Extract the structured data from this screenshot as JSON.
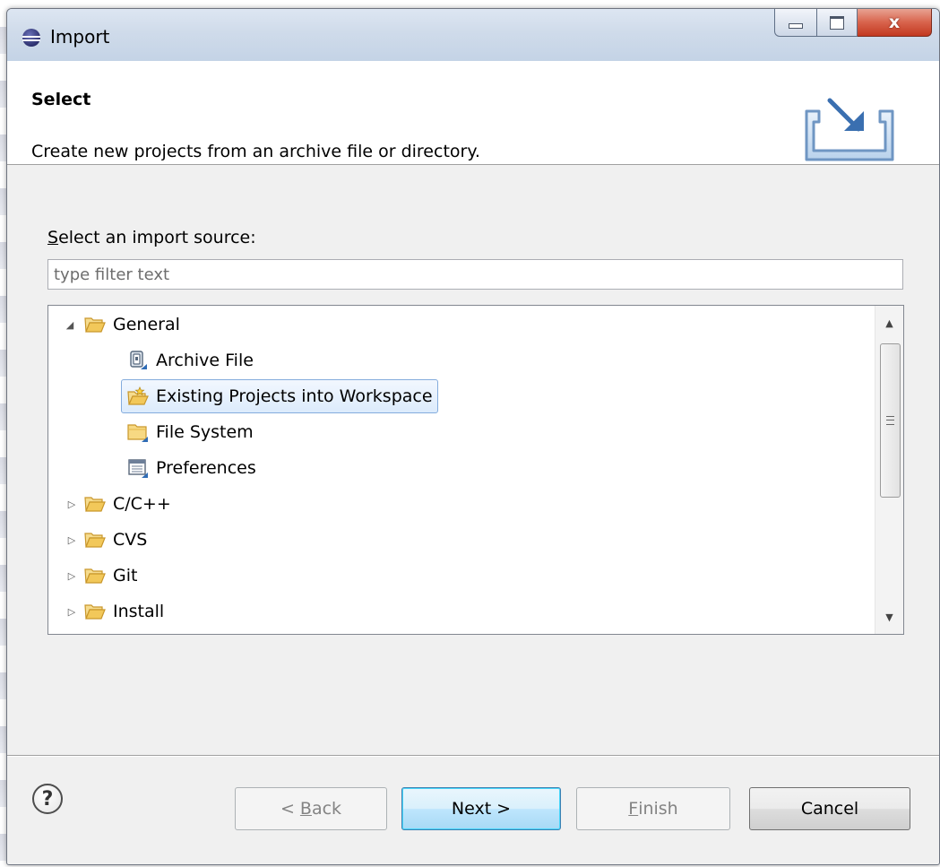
{
  "window": {
    "title": "Import",
    "controls": {
      "close_glyph": "x"
    }
  },
  "header": {
    "title": "Select",
    "description": "Create new projects from an archive file or directory.",
    "icon": "import-wizard-icon"
  },
  "source": {
    "label_mnemonic": "S",
    "label_rest": "elect an import source:",
    "filter_placeholder": "type filter text",
    "filter_value": ""
  },
  "tree": {
    "rows": [
      {
        "label": "General",
        "level": 0,
        "expanded": true,
        "icon": "folder-open-icon"
      },
      {
        "label": "Archive File",
        "level": 1,
        "icon": "archive-file-icon"
      },
      {
        "label": "Existing Projects into Workspace",
        "level": 1,
        "icon": "existing-projects-icon",
        "selected": true
      },
      {
        "label": "File System",
        "level": 1,
        "icon": "folder-icon"
      },
      {
        "label": "Preferences",
        "level": 1,
        "icon": "preferences-icon"
      },
      {
        "label": "C/C++",
        "level": 0,
        "expanded": false,
        "icon": "folder-open-icon"
      },
      {
        "label": "CVS",
        "level": 0,
        "expanded": false,
        "icon": "folder-open-icon"
      },
      {
        "label": "Git",
        "level": 0,
        "expanded": false,
        "icon": "folder-open-icon"
      },
      {
        "label": "Install",
        "level": 0,
        "expanded": false,
        "icon": "folder-open-icon"
      }
    ]
  },
  "footer": {
    "help_glyph": "?",
    "back": {
      "prefix": "< ",
      "mnemonic": "B",
      "rest": "ack"
    },
    "next": {
      "label": "Next >"
    },
    "finish": {
      "mnemonic": "F",
      "rest": "inish"
    },
    "cancel": {
      "label": "Cancel"
    }
  },
  "colors": {
    "selection_border": "#84acdd",
    "selection_fill": "#dcebfc",
    "default_button_border": "#3c7fb1",
    "close_button": "#c2391f",
    "folder_yellow": "#f2c85a"
  }
}
